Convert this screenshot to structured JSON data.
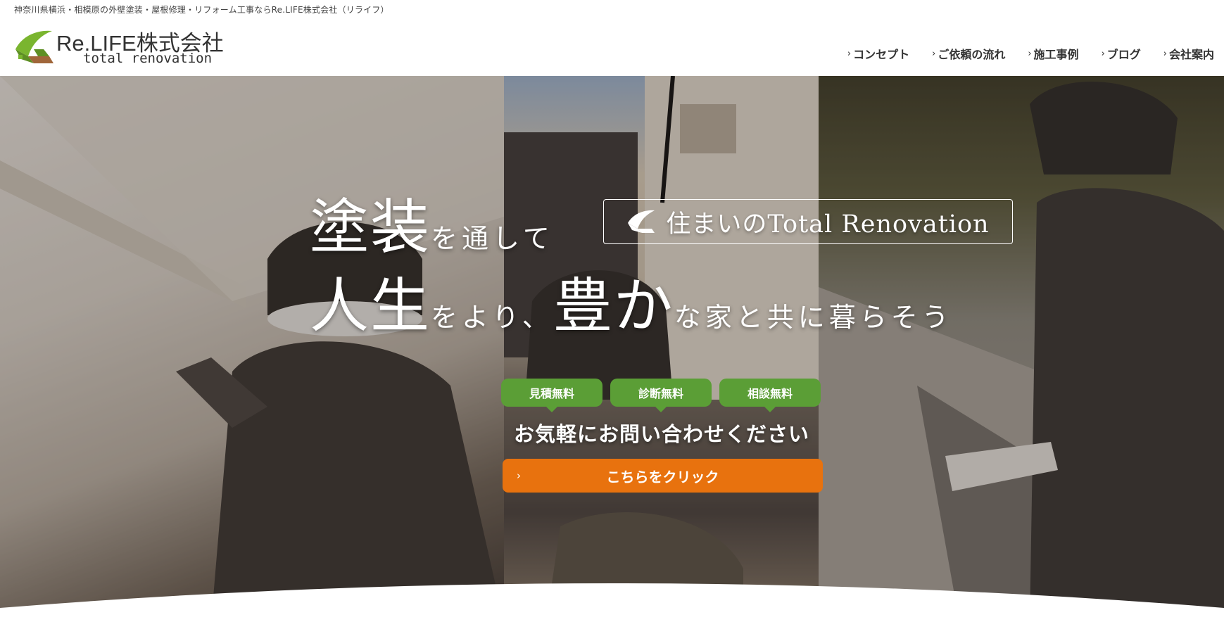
{
  "header": {
    "tagline": "神奈川県横浜・相模原の外壁塗装・屋根修理・リフォーム工事ならRe.LIFE株式会社（リライフ）",
    "logo_name": "Re.LIFE株式会社",
    "logo_sub": "total renovation"
  },
  "nav": {
    "items": [
      {
        "label": "コンセプト"
      },
      {
        "label": "ご依頼の流れ"
      },
      {
        "label": "施工事例"
      },
      {
        "label": "ブログ"
      },
      {
        "label": "会社案内"
      }
    ],
    "chevron": "›"
  },
  "hero": {
    "catch_line1": {
      "big": "塗装",
      "small": "を通して"
    },
    "badge_text": "住まいのTotal Renovation",
    "catch_line2": {
      "big1": "人生",
      "small1": "をより、",
      "big2": "豊か",
      "small2": "な家と共に暮らそう"
    },
    "badges": [
      "見積無料",
      "診断無料",
      "相談無料"
    ],
    "invite": "お気軽にお問い合わせください",
    "cta_label": "こちらをクリック",
    "cta_chevron": "›"
  },
  "colors": {
    "brand_green": "#5b9e36",
    "cta_orange": "#e8720e",
    "logo_green": "#7ab52f",
    "logo_brown": "#a0663a"
  }
}
